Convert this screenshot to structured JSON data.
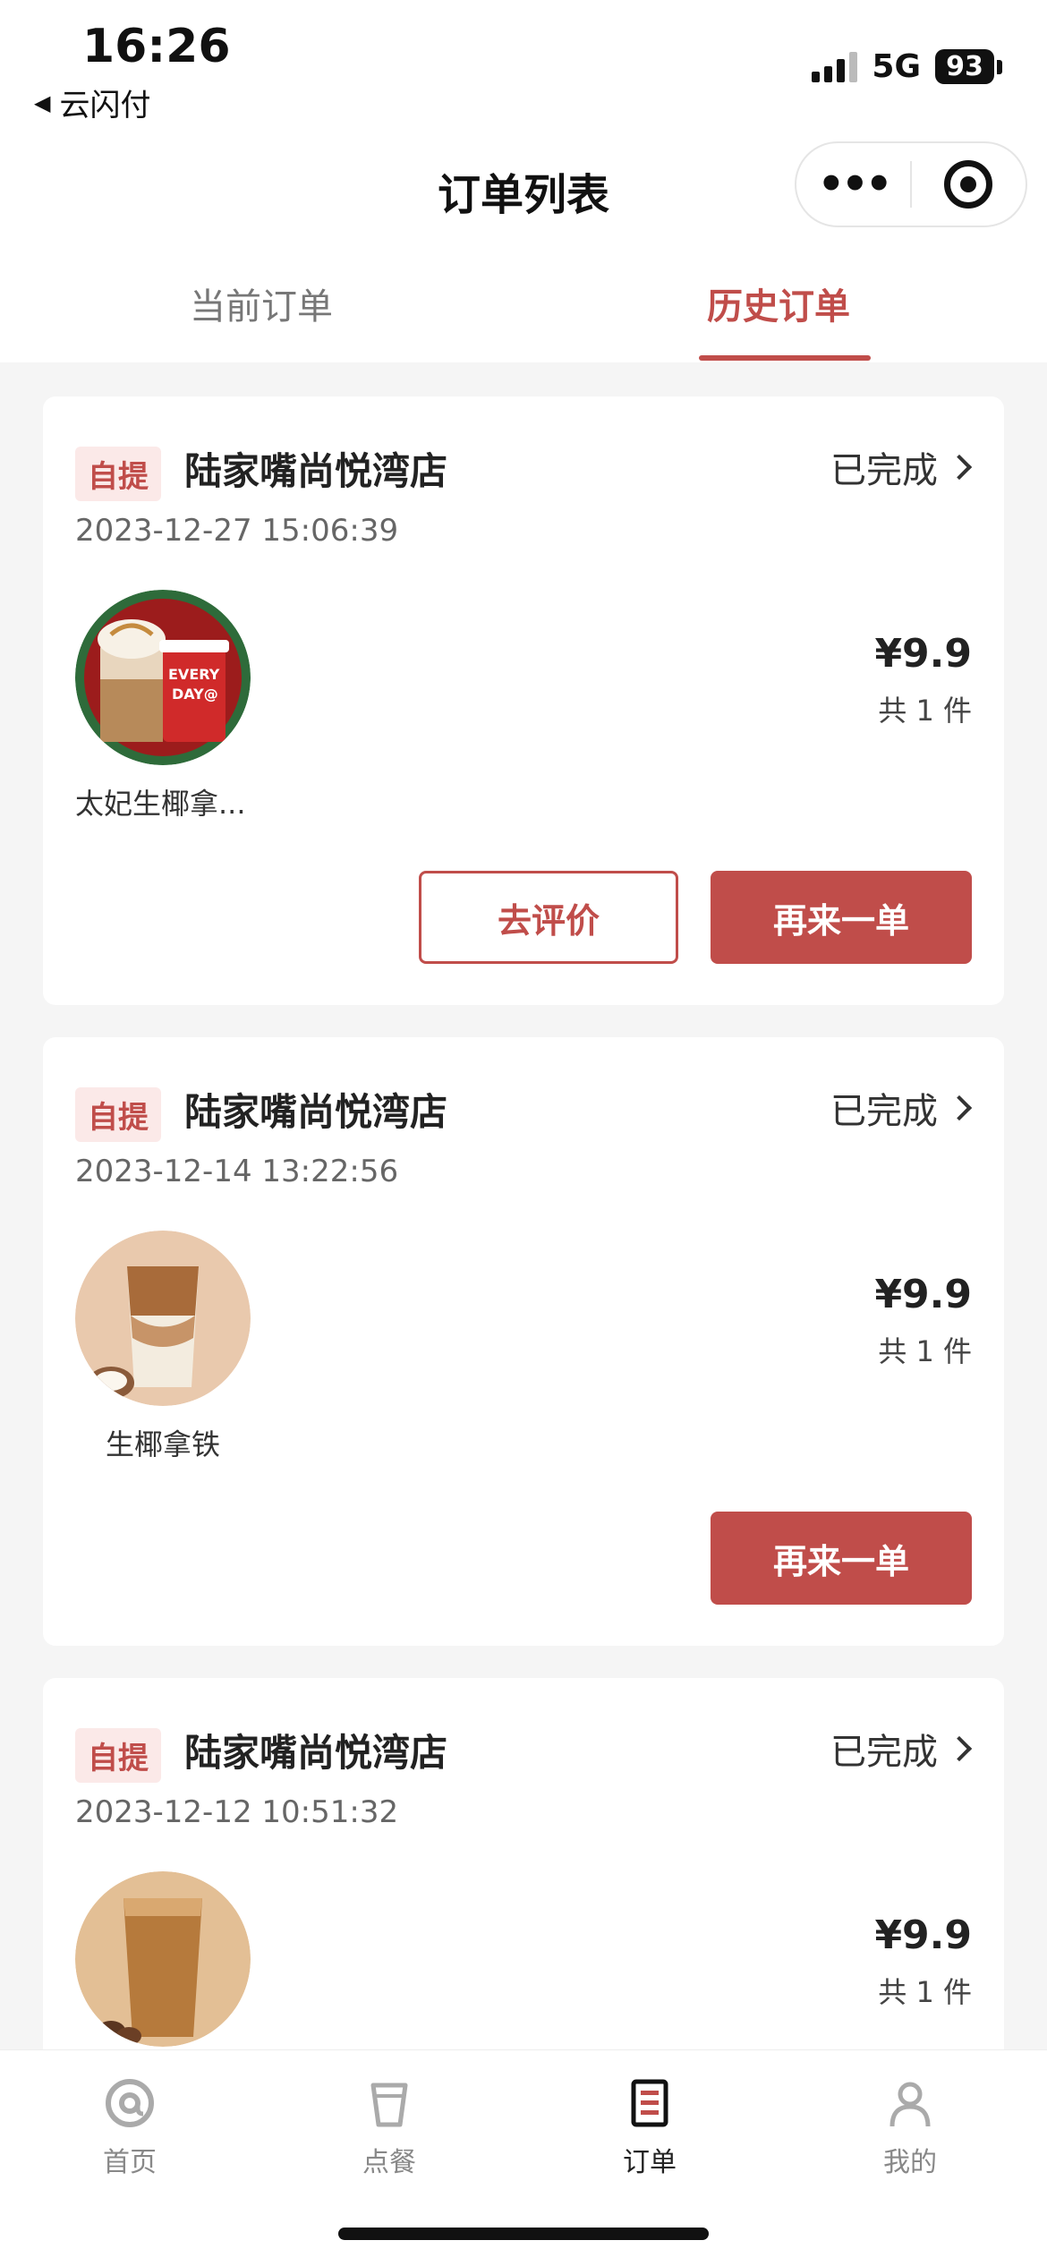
{
  "status_bar": {
    "time": "16:26",
    "back_app": "云闪付",
    "network": "5G",
    "battery": "93"
  },
  "header": {
    "title": "订单列表",
    "more_icon": "more-dots-icon",
    "close_icon": "target-icon"
  },
  "tabs": [
    {
      "label": "当前订单",
      "active": false
    },
    {
      "label": "历史订单",
      "active": true
    }
  ],
  "orders": [
    {
      "tag": "自提",
      "store": "陆家嘴尚悦湾店",
      "status": "已完成",
      "datetime": "2023-12-27 15:06:39",
      "product_name": "太妃生椰拿...",
      "price": "¥9.9",
      "quantity": "共 1 件",
      "buttons": [
        "去评价",
        "再来一单"
      ]
    },
    {
      "tag": "自提",
      "store": "陆家嘴尚悦湾店",
      "status": "已完成",
      "datetime": "2023-12-14 13:22:56",
      "product_name": "生椰拿铁",
      "price": "¥9.9",
      "quantity": "共 1 件",
      "buttons": [
        "再来一单"
      ]
    },
    {
      "tag": "自提",
      "store": "陆家嘴尚悦湾店",
      "status": "已完成",
      "datetime": "2023-12-12 10:51:32",
      "price": "¥9.9",
      "quantity": "共 1 件"
    }
  ],
  "tabbar": [
    {
      "label": "首页",
      "icon": "home-icon"
    },
    {
      "label": "点餐",
      "icon": "cup-icon"
    },
    {
      "label": "订单",
      "icon": "order-list-icon",
      "active": true
    },
    {
      "label": "我的",
      "icon": "profile-icon"
    }
  ],
  "colors": {
    "accent": "#c04d4a",
    "tag_bg": "#fbe9e8",
    "page_bg": "#f5f5f5"
  }
}
